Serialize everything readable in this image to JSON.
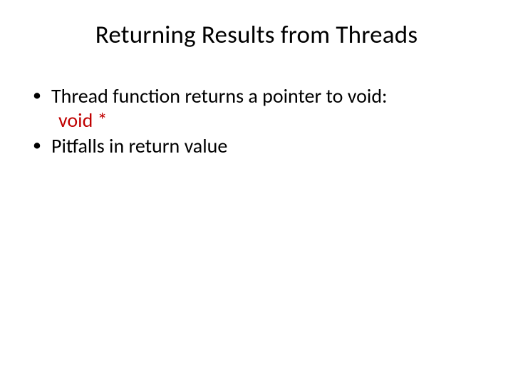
{
  "title": "Returning Results from Threads",
  "bullets": [
    {
      "text": "Thread function returns a pointer to void:",
      "sub": "void *"
    },
    {
      "text": "Pitfalls in return value"
    }
  ]
}
